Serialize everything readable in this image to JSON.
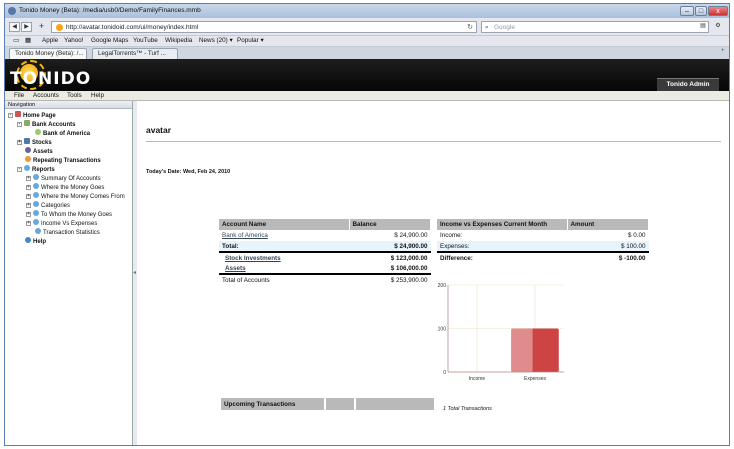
{
  "browser": {
    "title": "Tonido Money (Beta): /media/usb0/Demo/FamilyFinances.mmb",
    "url": "http://avatar.tonidoid.com/ui/money/index.html",
    "search_placeholder": "Google",
    "bookmarks": [
      "Apple",
      "Yahoo!",
      "Google Maps",
      "YouTube",
      "Wikipedia",
      "News (20) ▾",
      "Popular ▾"
    ],
    "tabs": [
      "Tonido Money (Beta): /...",
      "LegalTorrents™ - Turf ..."
    ]
  },
  "app": {
    "logo": "TONIDO",
    "admin_label": "Tonido Admin",
    "menu": [
      "File",
      "Accounts",
      "Tools",
      "Help"
    ]
  },
  "nav": {
    "header": "Navigation",
    "home": "Home Page",
    "bank_accounts": "Bank Accounts",
    "bank_of_america": "Bank of America",
    "stocks": "Stocks",
    "assets": "Assets",
    "repeating": "Repeating Transactions",
    "reports": "Reports",
    "report_items": [
      "Summary Of Accounts",
      "Where the Money Goes",
      "Where the Money Comes From",
      "Categories",
      "To Whom the Money Goes",
      "Income Vs Expenses",
      "Transaction Statistics"
    ],
    "help": "Help"
  },
  "main": {
    "title": "avatar",
    "date": "Today's Date: Wed, Feb 24, 2010",
    "accounts": {
      "col_name": "Account Name",
      "col_balance": "Balance",
      "rows": [
        {
          "name": "Bank of America",
          "balance": "$ 24,900.00"
        },
        {
          "name": "Total:",
          "balance": "$ 24,900.00"
        },
        {
          "name": "Stock Investments",
          "balance": "$ 123,000.00"
        },
        {
          "name": "Assets",
          "balance": "$ 106,000.00"
        },
        {
          "name": "Total of Accounts",
          "balance": "$ 253,900.00"
        }
      ]
    },
    "income": {
      "col_name": "Income vs Expenses Current Month",
      "col_amount": "Amount",
      "rows": [
        {
          "name": "Income:",
          "amount": "$ 0.00"
        },
        {
          "name": "Expenses:",
          "amount": "$ 100.00"
        },
        {
          "name": "Difference:",
          "amount": "$ -100.00"
        }
      ]
    },
    "upcoming": {
      "header": "Upcoming Transactions",
      "total": "1 Total Transactions"
    }
  },
  "chart_data": {
    "type": "bar",
    "categories": [
      "Income",
      "Expenses"
    ],
    "values": [
      0,
      100
    ],
    "ylim": [
      0,
      200
    ],
    "yticks": [
      0,
      100,
      200
    ],
    "bar_color": "#cc4444",
    "grid": true
  }
}
